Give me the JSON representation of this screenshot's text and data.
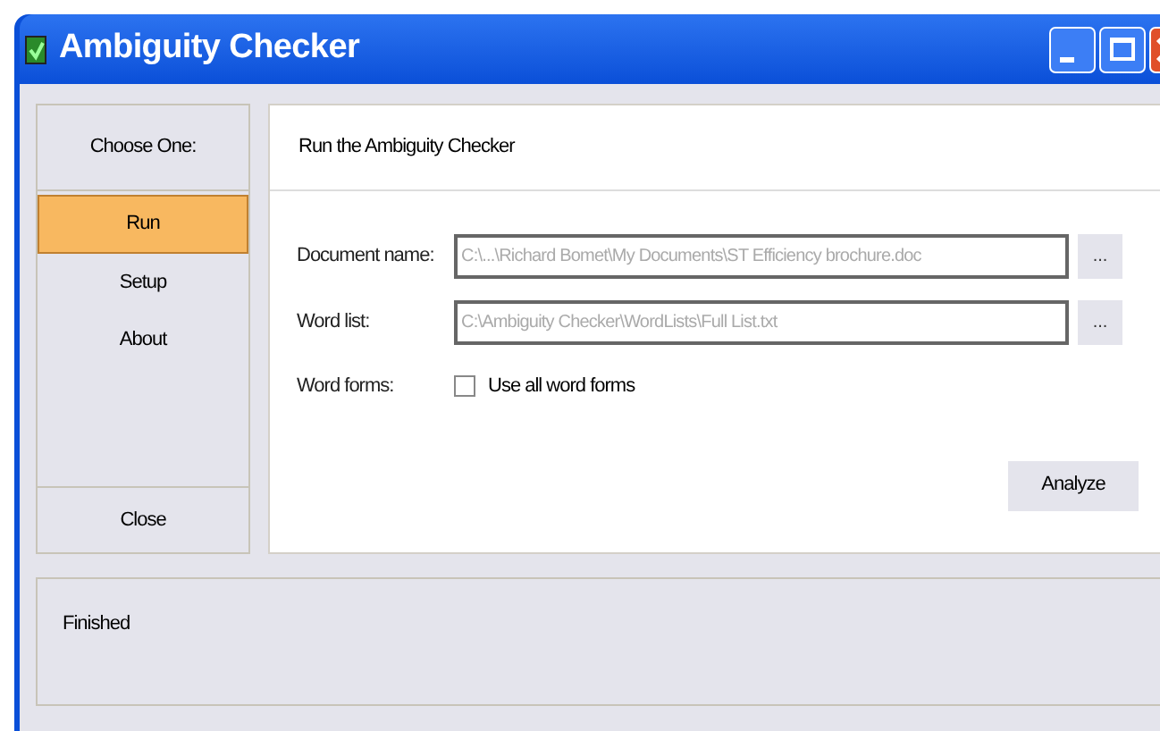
{
  "window": {
    "title": "Ambiguity Checker"
  },
  "sidebar": {
    "header": "Choose One:",
    "items": [
      {
        "label": "Run",
        "selected": true
      },
      {
        "label": "Setup",
        "selected": false
      },
      {
        "label": "About",
        "selected": false
      }
    ],
    "close_button": "Close"
  },
  "main": {
    "header": "Run the Ambiguity Checker",
    "document_name": {
      "label": "Document name:",
      "value": "C:\\...\\Richard Bomet\\My Documents\\ST Efficiency brochure.doc",
      "browse": "..."
    },
    "word_list": {
      "label": "Word list:",
      "value": "C:\\Ambiguity Checker\\WordLists\\Full List.txt",
      "browse": "..."
    },
    "word_forms": {
      "label": "Word forms:",
      "checkbox_label": "Use all word forms",
      "checked": false
    },
    "analyze_button": "Analyze"
  },
  "status_bar": {
    "text": "Finished"
  }
}
